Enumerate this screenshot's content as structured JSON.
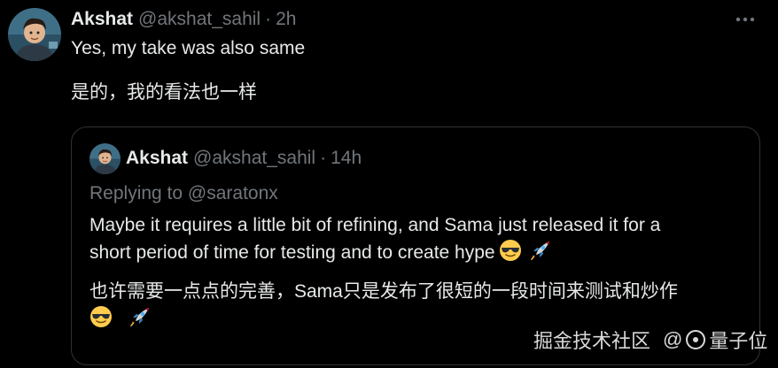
{
  "tweet": {
    "author": {
      "display_name": "Akshat",
      "handle": "@akshat_sahil",
      "separator": "·",
      "time": "2h"
    },
    "text_en": "Yes, my take was also same",
    "text_zh": "是的，我的看法也一样",
    "more_icon": "more-horizontal-icon"
  },
  "quote": {
    "author": {
      "display_name": "Akshat",
      "handle": "@akshat_sahil",
      "separator": "·",
      "time": "14h"
    },
    "replying_to": "Replying to @saratonx",
    "lines": [
      "Maybe it requires a little bit of refining, and Sama just released it for a",
      "short period of time for testing and to create hype",
      "也许需要一点点的完善，Sama只是发布了很短的一段时间来测试和炒作",
      ""
    ]
  },
  "watermark": {
    "part1": "掘金技术社区",
    "at": "@",
    "part2": "量子位"
  },
  "colors": {
    "background": "#000000",
    "text_primary": "#e7e9ea",
    "text_secondary": "#71767b",
    "border": "#2f3336"
  }
}
